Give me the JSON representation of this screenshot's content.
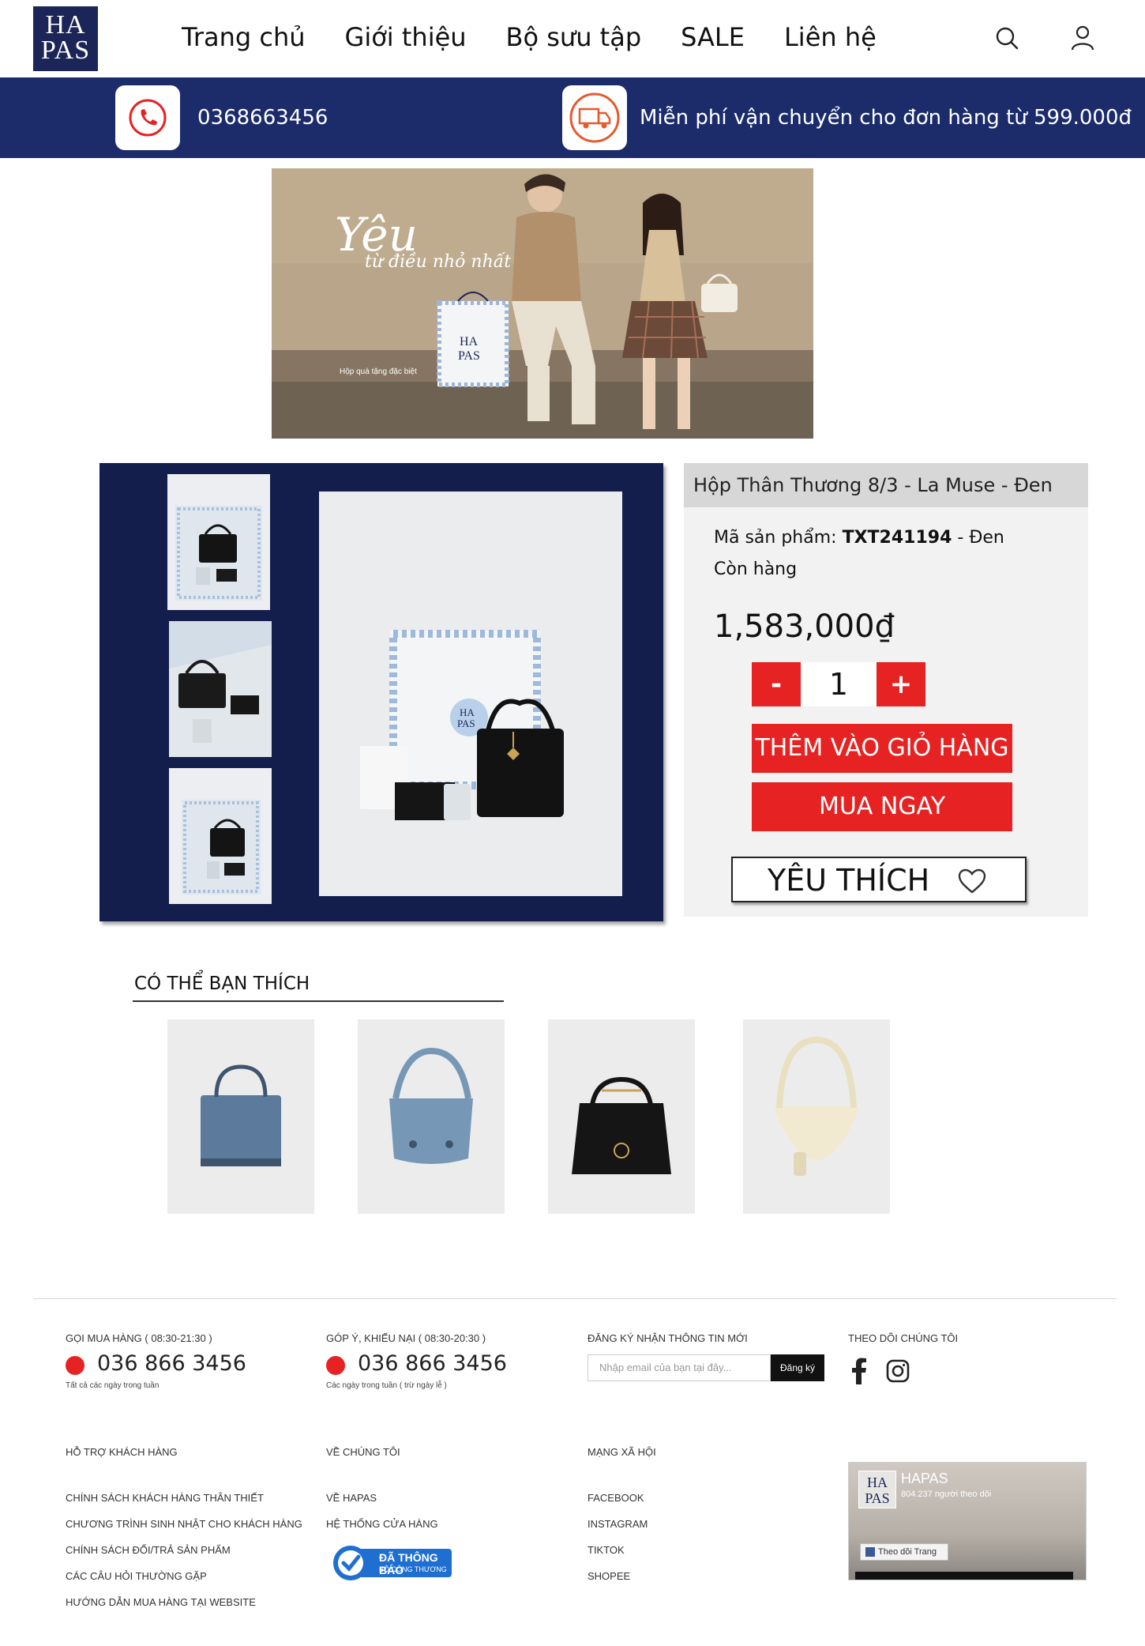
{
  "header": {
    "logo_top": "HA",
    "logo_bottom": "PAS",
    "nav": [
      "Trang chủ",
      "Giới thiệu",
      "Bộ sưu tập",
      "SALE",
      "Liên hệ"
    ]
  },
  "infobar": {
    "phone": "0368663456",
    "shipping": "Miễn phí vận chuyển cho đơn hàng từ 599.000đ"
  },
  "banner": {
    "script_main": "Yêu",
    "script_sub": "từ điều nhỏ nhất",
    "note": "Hộp quà tặng đặc biệt"
  },
  "product": {
    "title": "Hộp Thân Thương 8/3 - La Muse - Đen",
    "sku_label": "Mã sản phẩm: ",
    "sku_code": "TXT241194",
    "sku_suffix": " - Đen",
    "stock": "Còn hàng",
    "price": "1,583,000₫",
    "qty_minus": "-",
    "qty_value": "1",
    "qty_plus": "+",
    "add_to_cart": "THÊM VÀO GIỎ HÀNG",
    "buy_now": "MUA NGAY",
    "favorite": "YÊU THÍCH"
  },
  "related": {
    "title": "CÓ THỂ BẠN THÍCH"
  },
  "footer": {
    "order_head": "GỌI MUA HÀNG ( 08:30-21:30 )",
    "order_phone": "036 866 3456",
    "order_sub": "Tất cả các ngày trong tuần",
    "complaint_head": "GÓP Ý, KHIẾU NẠI ( 08:30-20:30 )",
    "complaint_phone": "036 866 3456",
    "complaint_sub": "Các ngày trong tuần ( trừ ngày lễ )",
    "newsletter_head": "ĐĂNG KÝ NHẬN THÔNG TIN MỚI",
    "email_placeholder": "Nhập email của bạn tại đây...",
    "subscribe": "Đăng ký",
    "follow_head": "THEO DÕI CHÚNG TÔI",
    "support_head": "HỖ TRỢ KHÁCH HÀNG",
    "support_links": [
      "CHÍNH SÁCH KHÁCH HÀNG THÂN THIẾT",
      "CHƯƠNG TRÌNH SINH NHẬT CHO KHÁCH HÀNG",
      "CHÍNH SÁCH ĐỔI/TRẢ SẢN PHẨM",
      "CÁC CÂU HỎI THƯỜNG GẶP",
      "HƯỚNG DẪN MUA HÀNG TẠI WEBSITE"
    ],
    "about_head": "VỀ CHÚNG TÔI",
    "about_links": [
      "VỀ HAPAS",
      "HỆ THỐNG CỬA HÀNG"
    ],
    "badge_line1": "ĐÃ THÔNG BÁO",
    "badge_line2": "BỘ CÔNG THƯƠNG",
    "social_head": "MẠNG XÃ HỘI",
    "social_links": [
      "FACEBOOK",
      "INSTAGRAM",
      "TIKTOK",
      "SHOPEE"
    ],
    "fb_page_name": "HAPAS",
    "fb_followers": "804.237 người theo dõi",
    "fb_follow": "Theo dõi Trang"
  },
  "colors": {
    "navy": "#1c2c6b",
    "red": "#e62222"
  }
}
